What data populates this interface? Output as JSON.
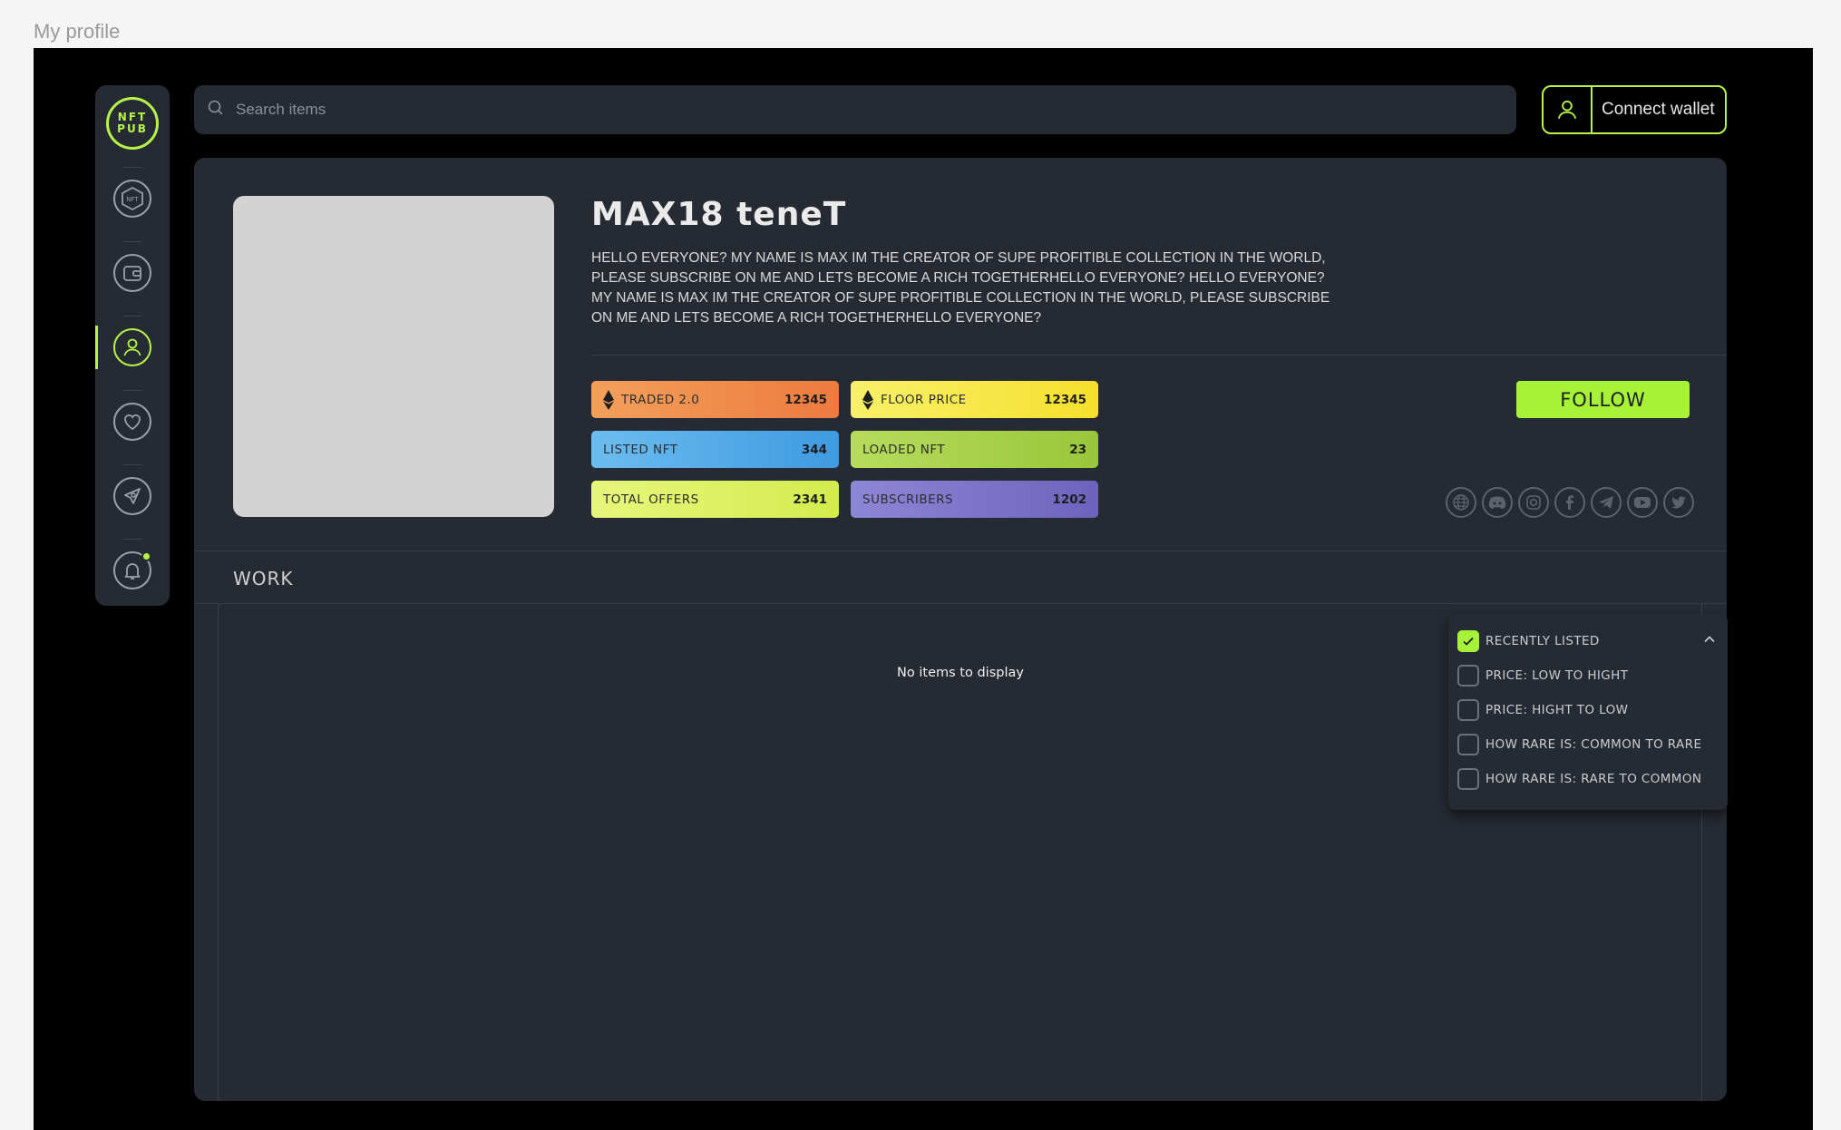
{
  "frame": {
    "label": "My profile"
  },
  "logo": {
    "line1": "NFT",
    "line2": "PUB"
  },
  "sidebar": {
    "items": [
      {
        "name": "nft-icon",
        "label": "NFT"
      },
      {
        "name": "wallet-icon"
      },
      {
        "name": "profile-icon",
        "active": true
      },
      {
        "name": "heart-icon"
      },
      {
        "name": "rocket-icon"
      },
      {
        "name": "bell-icon",
        "notification": true
      }
    ]
  },
  "search": {
    "placeholder": "Search items"
  },
  "connect": {
    "label": "Connect wallet"
  },
  "profile": {
    "name": "MAX18 teneT",
    "bio": "HELLO EVERYONE? MY NAME IS MAX IM THE CREATOR  OF SUPE  PROFITIBLE COLLECTION IN THE WORLD, PLEASE SUBSCRIBE ON ME  AND LETS BECOME A RICH TOGETHERHELLO EVERYONE? HELLO EVERYONE? MY NAME IS MAX IM THE CREATOR  OF SUPE  PROFITIBLE COLLECTION IN THE WORLD, PLEASE SUBSCRIBE ON ME  AND LETS BECOME A RICH TOGETHERHELLO EVERYONE?"
  },
  "stats": {
    "traded": {
      "label": "TRADED 2.0",
      "value": "12345"
    },
    "floor": {
      "label": "FLOOR PRICE",
      "value": "12345"
    },
    "listed": {
      "label": "LISTED NFT",
      "value": "344"
    },
    "loaded": {
      "label": "LOADED NFT",
      "value": "23"
    },
    "offers": {
      "label": "TOTAL OFFERS",
      "value": "2341"
    },
    "subscribers": {
      "label": "SUBSCRIBERS",
      "value": "1202"
    }
  },
  "follow": {
    "label": "FOLLOW"
  },
  "socials": [
    "globe-icon",
    "discord-icon",
    "instagram-icon",
    "facebook-icon",
    "telegram-icon",
    "youtube-icon",
    "twitter-icon"
  ],
  "work": {
    "title": "WORK",
    "empty": "No items to display"
  },
  "sort": {
    "options": [
      {
        "label": "RECENTLY LISTED",
        "checked": true
      },
      {
        "label": "PRICE: LOW TO HIGHT",
        "checked": false
      },
      {
        "label": "PRICE: HIGHT TO LOW",
        "checked": false
      },
      {
        "label": "HOW RARE IS: COMMON TO RARE",
        "checked": false
      },
      {
        "label": "HOW RARE IS: RARE TO COMMON",
        "checked": false
      }
    ]
  },
  "colors": {
    "accent": "#b6f34a",
    "follow": "#a5f239",
    "traded": "#f08a4b",
    "floor": "#f6ea3e",
    "listed": "#5aaee8",
    "loaded": "#a9d44b",
    "offers": "#dff26a",
    "subscribers": "#7d73c9"
  }
}
